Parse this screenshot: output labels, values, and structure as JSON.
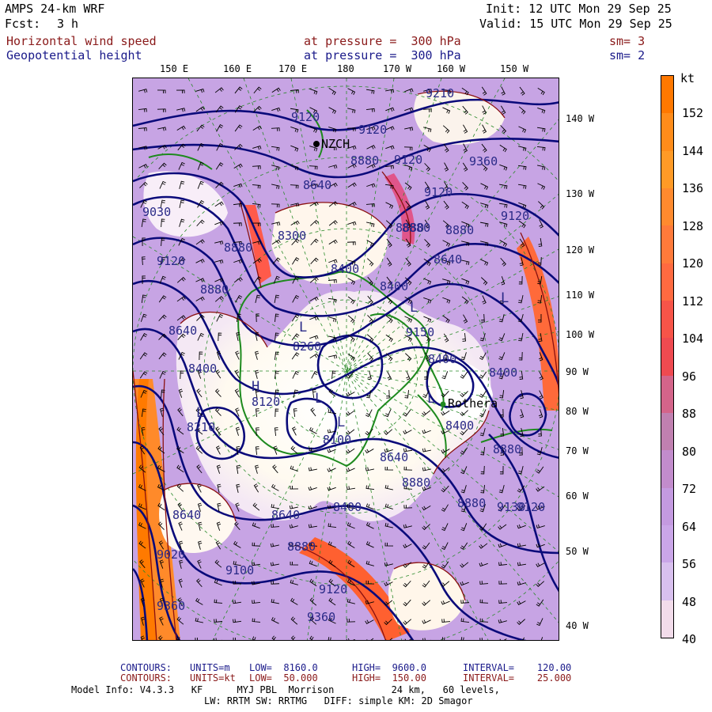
{
  "header": {
    "model": "AMPS 24-km WRF",
    "fcst_label": "Fcst:",
    "fcst_value": "3 h",
    "init": "Init: 12 UTC Mon 29 Sep 25",
    "valid": "Valid: 15 UTC Mon 29 Sep 25",
    "field1_name": "Horizontal wind speed",
    "field1_pressure": "at pressure =  300 hPa",
    "field1_sm": "sm= 3",
    "field2_name": "Geopotential height",
    "field2_pressure": "at pressure =  300 hPa",
    "field2_sm": "sm= 2"
  },
  "top_longitude_labels": [
    "150 E",
    "160 E",
    "170 E",
    "180",
    "170 W",
    "160 W",
    "150 W"
  ],
  "right_longitude_labels": [
    "140 W",
    "130 W",
    "120 W",
    "110 W",
    "100 W",
    "90 W",
    "80 W",
    "70 W",
    "60 W",
    "50 W",
    "40 W"
  ],
  "colorbar": {
    "unit": "kt",
    "ticks": [
      "152",
      "144",
      "136",
      "128",
      "120",
      "112",
      "104",
      "96",
      "88",
      "80",
      "72",
      "64",
      "56",
      "48",
      "40"
    ],
    "colors": {
      "low": "#fffbe8",
      "mid": "#c6a0e6",
      "high": "#ff8a1a",
      "peak": "#ff7a00"
    }
  },
  "map_labels": {
    "heights": [
      "9210",
      "9120",
      "9120",
      "8880",
      "9120",
      "9360",
      "8640",
      "9120",
      "9030",
      "8300",
      "8880",
      "8880",
      "8880",
      "9120",
      "9120",
      "8400",
      "8640",
      "8400",
      "8880",
      "9150",
      "8260",
      "8640",
      "8400",
      "8400",
      "8210",
      "8120",
      "8400",
      "8100",
      "8640",
      "8400",
      "8880",
      "8880",
      "8640",
      "8640",
      "8400",
      "9020",
      "8880",
      "9120",
      "9100",
      "9360",
      "8880",
      "9120",
      "9360",
      "9130",
      "8880"
    ],
    "lows": [
      "L",
      "L",
      "L",
      "L",
      "L",
      "L",
      "L"
    ],
    "highs": [
      "H"
    ],
    "stations": [
      "NZCH",
      "Rothera"
    ]
  },
  "footer": {
    "contours1_label": "CONTOURS:",
    "contours1_units": "UNITS=m",
    "contours1_low": "LOW=  8160.0",
    "contours1_high": "HIGH=  9600.0",
    "contours1_interval": "INTERVAL=    120.00",
    "contours2_label": "CONTOURS:",
    "contours2_units": "UNITS=kt",
    "contours2_low": "LOW=  50.000",
    "contours2_high": "HIGH=  150.00",
    "contours2_interval": "INTERVAL=    25.000",
    "model_info": "Model Info: V4.3.3   KF      MYJ PBL  Morrison          24 km,   60 levels,",
    "model_info2": "LW: RRTM SW: RRTMG   DIFF: simple KM: 2D Smagor"
  }
}
